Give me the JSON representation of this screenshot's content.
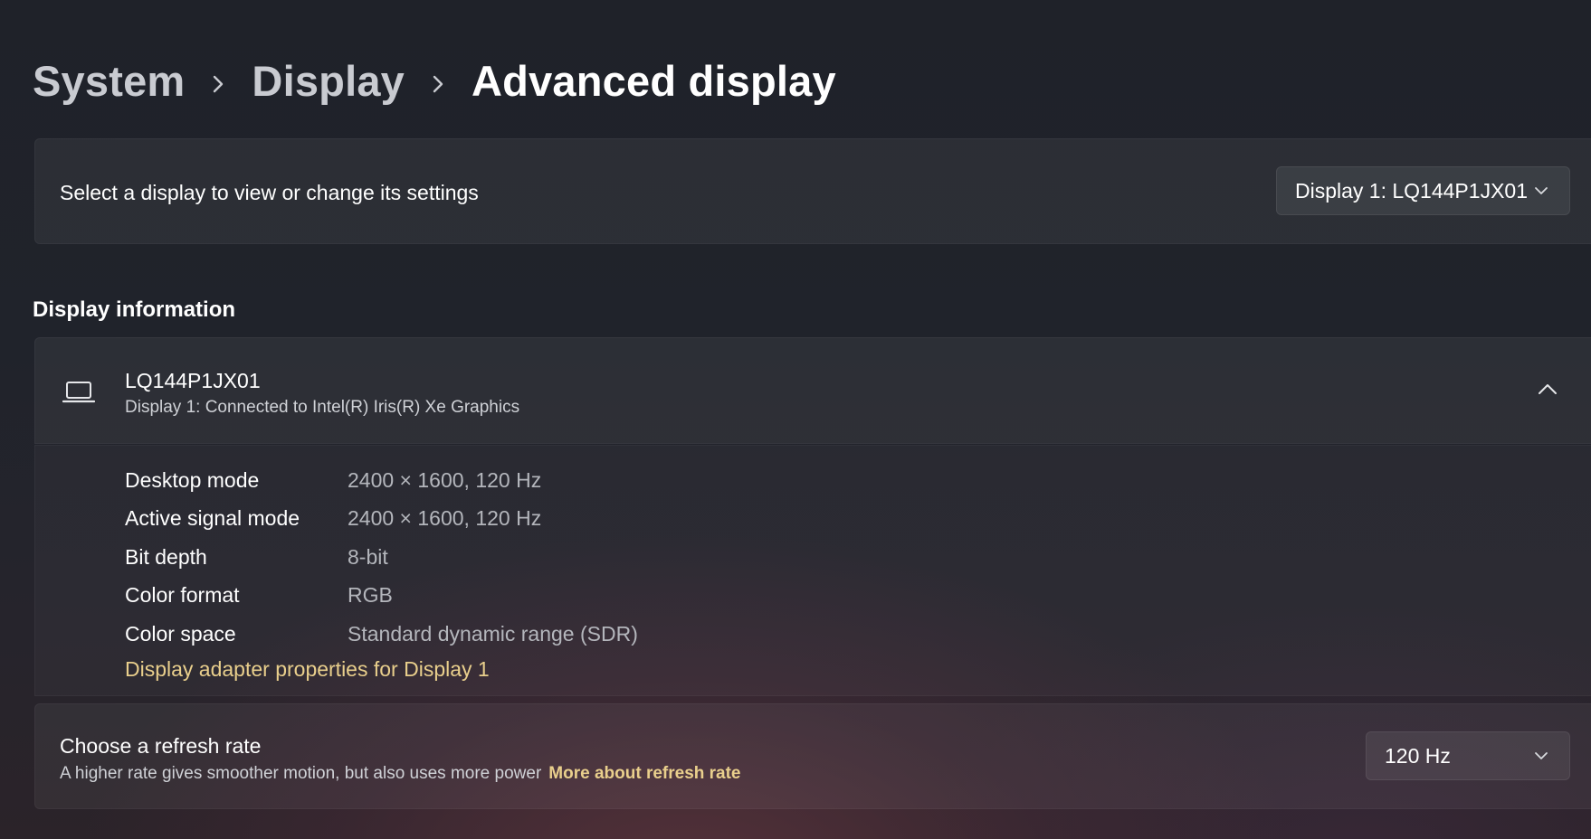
{
  "breadcrumb": {
    "items": [
      "System",
      "Display",
      "Advanced display"
    ]
  },
  "display_select": {
    "label": "Select a display to view or change its settings",
    "selected": "Display 1: LQ144P1JX01"
  },
  "display_information": {
    "section_title": "Display information",
    "name": "LQ144P1JX01",
    "connection": "Display 1: Connected to Intel(R) Iris(R) Xe Graphics",
    "icon": "laptop-icon",
    "expanded": true,
    "rows": [
      {
        "key": "Desktop mode",
        "value": "2400 × 1600, 120 Hz"
      },
      {
        "key": "Active signal mode",
        "value": "2400 × 1600, 120 Hz"
      },
      {
        "key": "Bit depth",
        "value": "8-bit"
      },
      {
        "key": "Color format",
        "value": "RGB"
      },
      {
        "key": "Color space",
        "value": "Standard dynamic range (SDR)"
      }
    ],
    "adapter_link": "Display adapter properties for Display 1"
  },
  "refresh_rate": {
    "title": "Choose a refresh rate",
    "description": "A higher rate gives smoother motion, but also uses more power",
    "link": "More about refresh rate",
    "selected": "120 Hz"
  },
  "colors": {
    "accent_link": "#e9cf8c",
    "card_background": "rgba(255,255,255,0.055)",
    "secondary_text": "#b4b6bc"
  }
}
